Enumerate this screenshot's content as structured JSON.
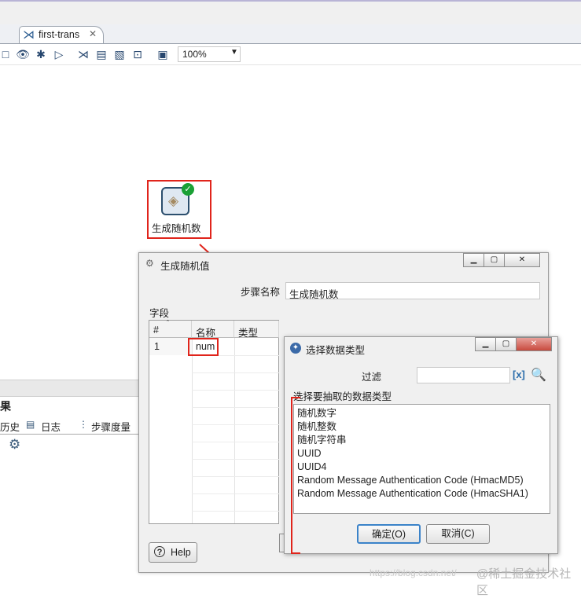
{
  "tab": {
    "title": "first-trans",
    "close": "✕"
  },
  "toolbar": {
    "zoom": "100%"
  },
  "canvas": {
    "step_label": "生成随机数"
  },
  "bottom_panel": {
    "title": "果",
    "tab_history": "历史",
    "tab_log": "日志",
    "tab_metrics": "步骤度量"
  },
  "dialog_step": {
    "title": "生成随机值",
    "step_name_label": "步骤名称",
    "step_name_value": "生成随机数",
    "fields_label": "字段",
    "columns": [
      "#",
      "名称",
      "类型"
    ],
    "rows": [
      {
        "index": "1",
        "name": "num",
        "type": ""
      }
    ],
    "help": "Help"
  },
  "dialog_type": {
    "title": "选择数据类型",
    "filter_label": "过滤",
    "filter_value": "",
    "hint": "选择要抽取的数据类型",
    "options": [
      "随机数字",
      "随机整数",
      "随机字符串",
      "UUID",
      "UUID4",
      "Random Message Authentication Code (HmacMD5)",
      "Random Message Authentication Code (HmacSHA1)"
    ],
    "ok": "确定(O)",
    "cancel": "取消(C)"
  },
  "watermark": {
    "url": "https://blog.csdn.net/",
    "brand": "@稀土掘金技术社区"
  },
  "colors": {
    "annotation": "#e0241b",
    "status_ok": "#1aa035"
  }
}
